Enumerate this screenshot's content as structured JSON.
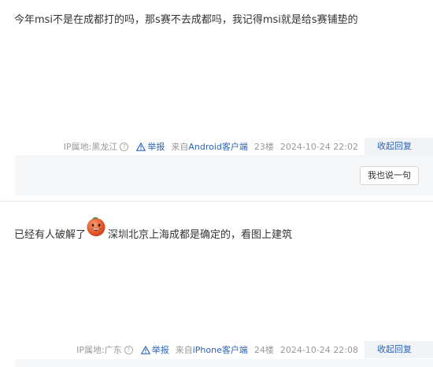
{
  "posts": [
    {
      "text": "今年msi不是在成都打的吗，那s赛不去成都吗，我记得msi就是给s赛铺垫的",
      "ip": "IP属地:黑龙江",
      "report": "举报",
      "client_prefix": "来自",
      "client": "Android客户端",
      "floor": "23楼",
      "time": "2024-10-24 22:02",
      "reply_toggle": "收起回复",
      "say_button": "我也说一句"
    },
    {
      "text_before": "已经有人破解了",
      "text_after": "深圳北京上海成都是确定的，看图上建筑",
      "ip": "IP属地:广东",
      "report": "举报",
      "client_prefix": "来自",
      "client": "iPhone客户端",
      "floor": "24楼",
      "time": "2024-10-24 22:08",
      "reply_toggle": "收起回复"
    }
  ],
  "icons": {
    "help": "question-circle-icon",
    "report": "warning-triangle-icon",
    "emoji": "grinning-face-emoji"
  },
  "colors": {
    "link": "#2d64b3",
    "meta": "#999999",
    "reply_bg": "#f5f6f8"
  }
}
